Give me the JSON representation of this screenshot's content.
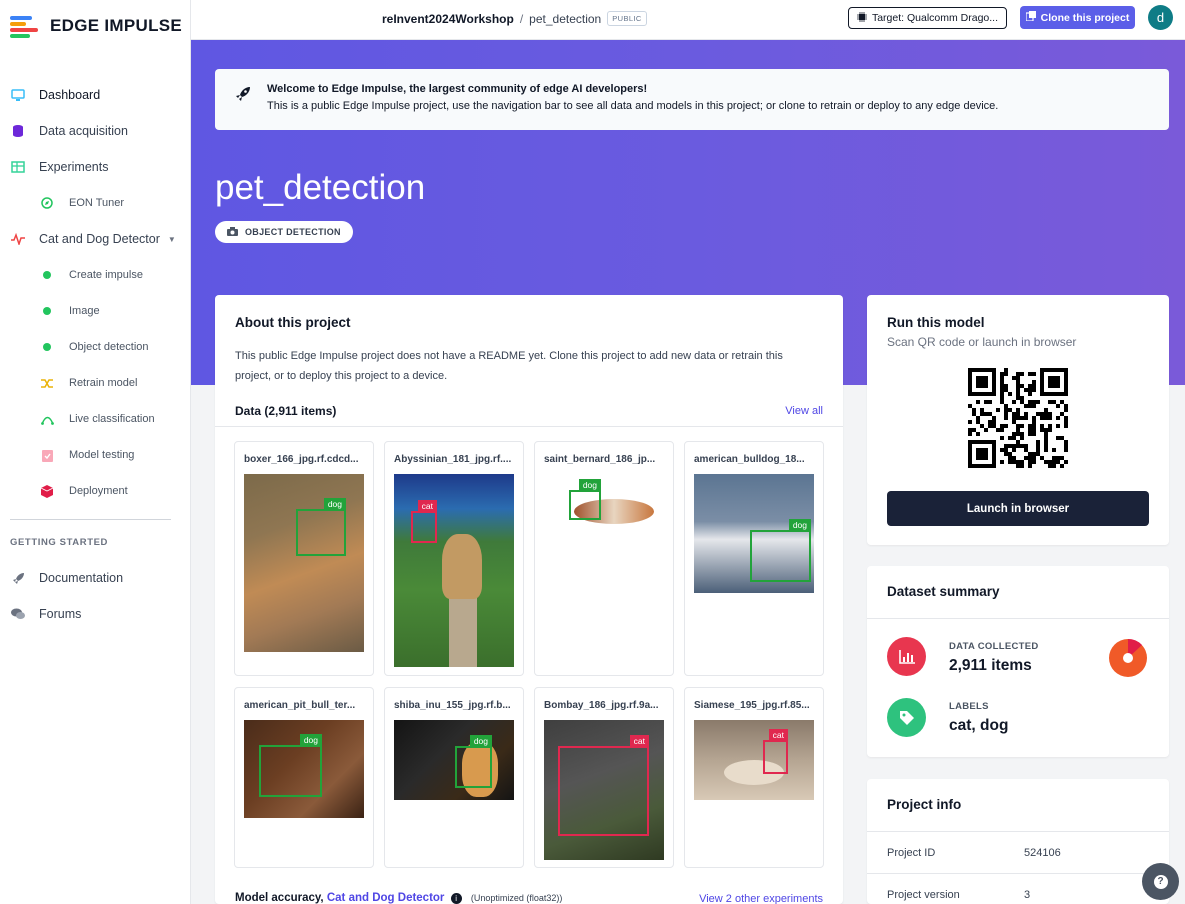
{
  "app": {
    "logo_text": "EDGE IMPULSE"
  },
  "sidebar": {
    "items": [
      {
        "label": "Dashboard",
        "icon": "monitor-icon"
      },
      {
        "label": "Data acquisition",
        "icon": "database-icon"
      },
      {
        "label": "Experiments",
        "icon": "table-icon"
      },
      {
        "label": "EON Tuner",
        "icon": "compass-icon"
      },
      {
        "label": "Cat and Dog Detector",
        "icon": "pulse-icon"
      },
      {
        "label": "Create impulse",
        "icon": "green-dot-icon"
      },
      {
        "label": "Image",
        "icon": "green-dot-icon"
      },
      {
        "label": "Object detection",
        "icon": "green-dot-icon"
      },
      {
        "label": "Retrain model",
        "icon": "shuffle-icon"
      },
      {
        "label": "Live classification",
        "icon": "signal-icon"
      },
      {
        "label": "Model testing",
        "icon": "clipboard-check-icon"
      },
      {
        "label": "Deployment",
        "icon": "cube-icon"
      }
    ],
    "section_label": "GETTING STARTED",
    "getting_started": [
      {
        "label": "Documentation",
        "icon": "rocket-icon"
      },
      {
        "label": "Forums",
        "icon": "comments-icon"
      }
    ]
  },
  "topbar": {
    "project_owner": "reInvent2024Workshop",
    "separator": "/",
    "project_name": "pet_detection",
    "visibility": "PUBLIC",
    "target_label": "Target: Qualcomm Drago...",
    "clone_label": "Clone this project",
    "avatar_initial": "d"
  },
  "welcome": {
    "title": "Welcome to Edge Impulse, the largest community of edge AI developers!",
    "body": "This is a public Edge Impulse project, use the navigation bar to see all data and models in this project; or clone to retrain or deploy to any edge device."
  },
  "hero": {
    "title": "pet_detection",
    "type_badge": "OBJECT DETECTION"
  },
  "about": {
    "title": "About this project",
    "description": "This public Edge Impulse project does not have a README yet. Clone this project to add new data or retrain this project, or to deploy this project to a device.",
    "data_label": "Data (2,911 items)",
    "view_all": "View all",
    "items": [
      {
        "name": "boxer_166_jpg.rf.cdcd...",
        "label": "dog"
      },
      {
        "name": "Abyssinian_181_jpg.rf....",
        "label": "cat"
      },
      {
        "name": "saint_bernard_186_jp...",
        "label": "dog"
      },
      {
        "name": "american_bulldog_18...",
        "label": "dog"
      },
      {
        "name": "american_pit_bull_ter...",
        "label": "dog"
      },
      {
        "name": "shiba_inu_155_jpg.rf.b...",
        "label": "dog"
      },
      {
        "name": "Bombay_186_jpg.rf.9a...",
        "label": "cat"
      },
      {
        "name": "Siamese_195_jpg.rf.85...",
        "label": "cat"
      }
    ],
    "accuracy_title": "Model accuracy,",
    "accuracy_link": "Cat and Dog Detector",
    "accuracy_sub": "(Unoptimized (float32))",
    "accuracy_right": "View 2 other experiments"
  },
  "run": {
    "title": "Run this model",
    "subtitle": "Scan QR code or launch in browser",
    "launch": "Launch in browser"
  },
  "summary": {
    "title": "Dataset summary",
    "collected_label": "DATA COLLECTED",
    "collected_value": "2,911 items",
    "labels_label": "LABELS",
    "labels_value": "cat, dog"
  },
  "info": {
    "title": "Project info",
    "rows": [
      {
        "key": "Project ID",
        "value": "524106"
      },
      {
        "key": "Project version",
        "value": "3"
      }
    ]
  },
  "colors": {
    "accent": "#5b5ee8",
    "dog_box": "#22a33a",
    "cat_box": "#e0284f",
    "data_icon": "#e8364f",
    "label_icon": "#2ec27e"
  }
}
